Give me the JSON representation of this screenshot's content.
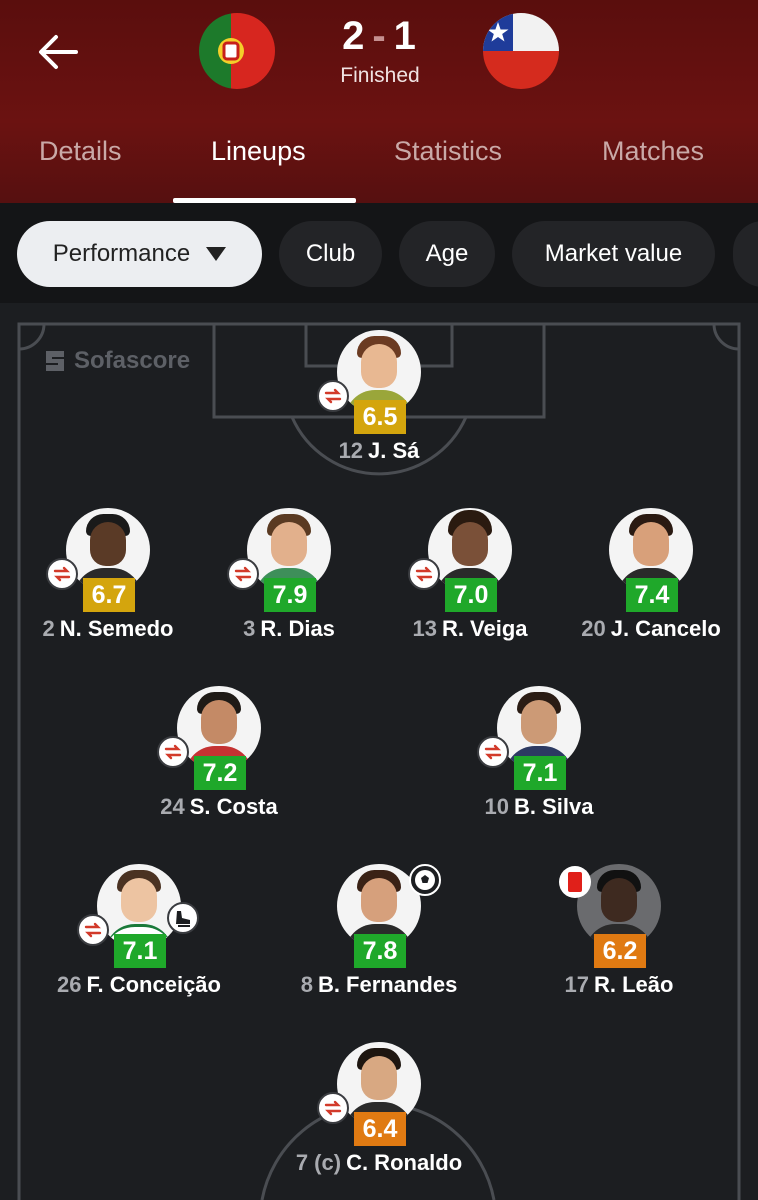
{
  "match": {
    "home_team_flag": "portugal-flag",
    "away_team_flag": "chile-flag",
    "home_score": "2",
    "separator": "-",
    "away_score": "1",
    "status": "Finished"
  },
  "tabs": [
    {
      "label": "Details"
    },
    {
      "label": "Lineups"
    },
    {
      "label": "Statistics"
    },
    {
      "label": "Matches"
    }
  ],
  "filters": {
    "performance": "Performance",
    "club": "Club",
    "age": "Age",
    "market_value": "Market value"
  },
  "watermark": "Sofascore",
  "colors": {
    "header_bg": "#6b1211",
    "rating_green": "#1fa82a",
    "rating_yellow": "#d4a50d",
    "rating_orange": "#e07a12"
  },
  "players": [
    {
      "number": "12",
      "name": "J. Sá",
      "rating": "6.5",
      "rating_color": "yellow",
      "sub": true
    },
    {
      "number": "2",
      "name": "N. Semedo",
      "rating": "6.7",
      "rating_color": "yellow",
      "sub": true
    },
    {
      "number": "3",
      "name": "R. Dias",
      "rating": "7.9",
      "rating_color": "green",
      "sub": true
    },
    {
      "number": "13",
      "name": "R. Veiga",
      "rating": "7.0",
      "rating_color": "green",
      "sub": true
    },
    {
      "number": "20",
      "name": "J. Cancelo",
      "rating": "7.4",
      "rating_color": "green",
      "sub": false
    },
    {
      "number": "24",
      "name": "S. Costa",
      "rating": "7.2",
      "rating_color": "green",
      "sub": true
    },
    {
      "number": "10",
      "name": "B. Silva",
      "rating": "7.1",
      "rating_color": "green",
      "sub": true
    },
    {
      "number": "26",
      "name": "F. Conceição",
      "rating": "7.1",
      "rating_color": "green",
      "sub": true,
      "assist": true
    },
    {
      "number": "8",
      "name": "B. Fernandes",
      "rating": "7.8",
      "rating_color": "green",
      "sub": false,
      "goal": true
    },
    {
      "number": "17",
      "name": "R. Leão",
      "rating": "6.2",
      "rating_color": "orange",
      "sub": false,
      "red_card": true
    },
    {
      "number": "7 (c)",
      "name": "C. Ronaldo",
      "rating": "6.4",
      "rating_color": "orange",
      "sub": true
    }
  ]
}
